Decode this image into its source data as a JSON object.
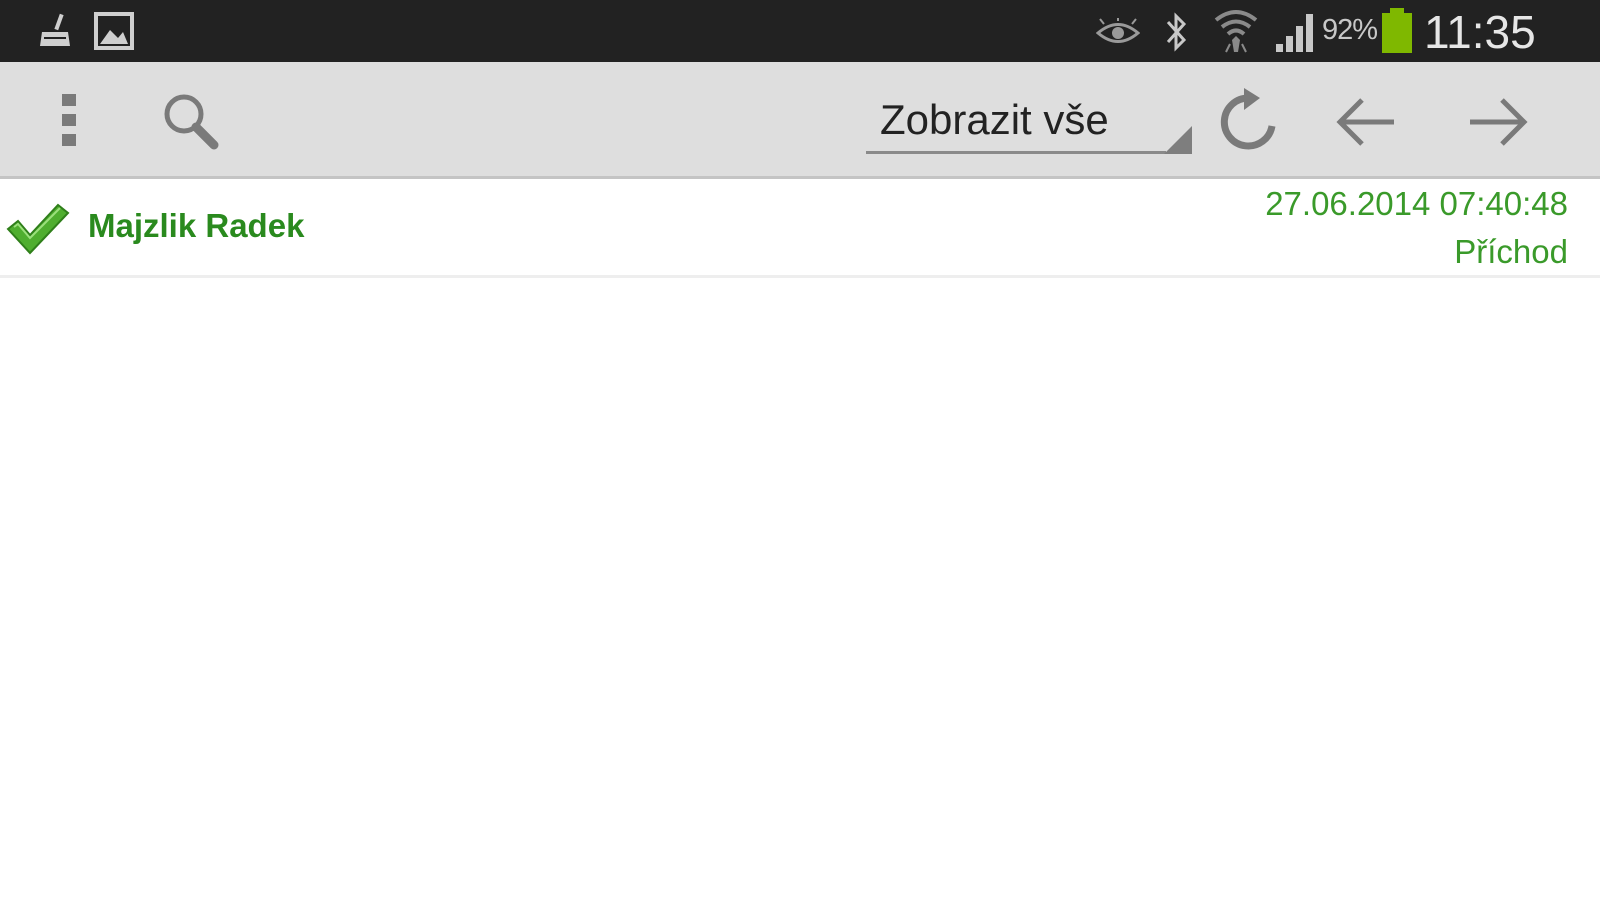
{
  "status_bar": {
    "battery_percent": "92%",
    "time": "11:35",
    "icons": [
      "broom-icon",
      "image-icon",
      "eye-icon",
      "bluetooth-icon",
      "wifi-icon",
      "signal-icon",
      "battery-icon"
    ],
    "battery_color": "#7fb800"
  },
  "toolbar": {
    "icons": [
      "overflow-menu-icon",
      "search-icon",
      "refresh-icon",
      "arrow-left-icon",
      "arrow-right-icon"
    ],
    "filter_spinner": {
      "selected": "Zobrazit vše"
    }
  },
  "list": {
    "items": [
      {
        "status_icon": "checkmark-icon",
        "name": "Majzlik Radek",
        "datetime": "27.06.2014 07:40:48",
        "type": "Příchod"
      }
    ]
  },
  "colors": {
    "status_bar_bg": "#222222",
    "toolbar_bg": "#dedede",
    "accent_green": "#2a8a1e"
  }
}
